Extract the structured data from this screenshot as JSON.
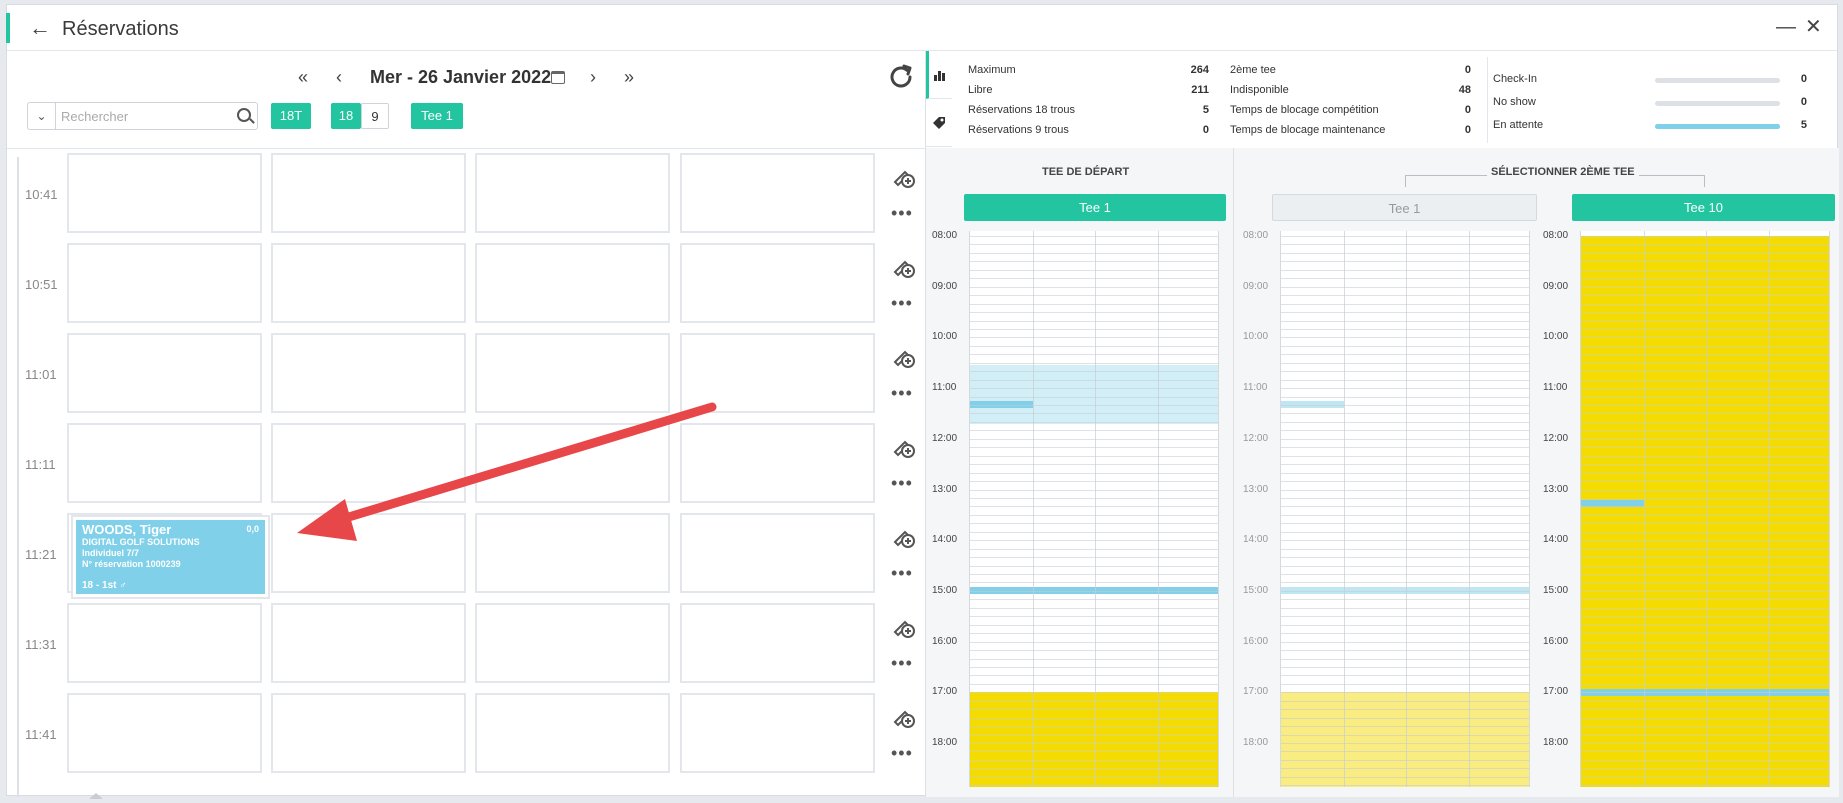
{
  "window": {
    "title": "Réservations",
    "back": "←",
    "minimize": "—",
    "close": "✕"
  },
  "nav": {
    "first": "«",
    "prev": "‹",
    "next": "›",
    "last": "»",
    "date": "Mer - 26 Janvier 2022"
  },
  "search": {
    "placeholder": "Rechercher"
  },
  "filters": {
    "type": "18T",
    "holes_18": "18",
    "holes_9": "9",
    "tee": "Tee 1"
  },
  "times": [
    "10:41",
    "10:51",
    "11:01",
    "11:11",
    "11:21",
    "11:31",
    "11:41"
  ],
  "booking": {
    "name": "WOODS, Tiger",
    "company": "DIGITAL GOLF SOLUTIONS",
    "type": "Individuel 7/7",
    "reservation": "N° réservation 1000239",
    "footer": "18 - 1st ♂",
    "score": "0,0"
  },
  "stats": {
    "col1": [
      {
        "label": "Maximum",
        "value": "264"
      },
      {
        "label": "Libre",
        "value": "211"
      },
      {
        "label": "Réservations 18 trous",
        "value": "5"
      },
      {
        "label": "Réservations 9 trous",
        "value": "0"
      }
    ],
    "col2": [
      {
        "label": "2ème tee",
        "value": "0"
      },
      {
        "label": "Indisponible",
        "value": "48"
      },
      {
        "label": "Temps de blocage compétition",
        "value": "0"
      },
      {
        "label": "Temps de blocage maintenance",
        "value": "0"
      }
    ],
    "col3": [
      {
        "label": "Check-In",
        "value": "0",
        "fill": 0
      },
      {
        "label": "No show",
        "value": "0",
        "fill": 0
      },
      {
        "label": "En attente",
        "value": "5",
        "fill": 1
      }
    ]
  },
  "tee_depart": {
    "title": "TEE DE DÉPART",
    "tee": "Tee 1"
  },
  "second_tee": {
    "title": "SÉLECTIONNER 2ÈME TEE",
    "tee_a": "Tee 1",
    "tee_b": "Tee 10"
  },
  "hours": [
    "08:00",
    "09:00",
    "10:00",
    "11:00",
    "12:00",
    "13:00",
    "14:00",
    "15:00",
    "16:00",
    "17:00",
    "18:00"
  ],
  "colors": {
    "accent": "#22c5a0",
    "booked": "#7fd0e8",
    "blocked": "#f5dc00",
    "arrow": "#e8474a"
  }
}
